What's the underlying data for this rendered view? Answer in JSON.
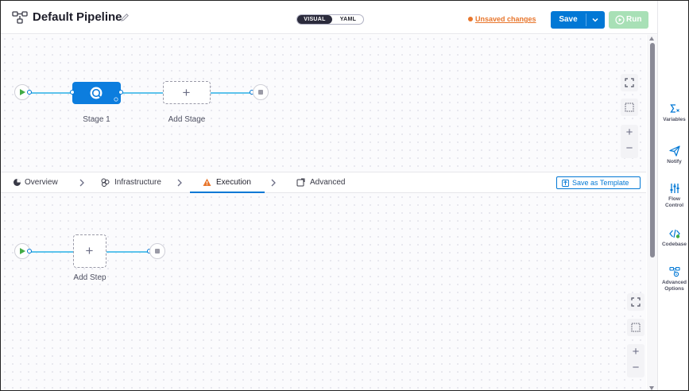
{
  "header": {
    "title": "Default Pipeline",
    "view_toggle": {
      "visual": "VISUAL",
      "yaml": "YAML",
      "selected": "VISUAL"
    },
    "unsaved": "Unsaved changes",
    "save_label": "Save",
    "run_label": "Run"
  },
  "stages": {
    "stage_label": "Stage 1",
    "add_stage_label": "Add Stage",
    "plus": "+"
  },
  "tabs": {
    "items": [
      {
        "label": "Overview"
      },
      {
        "label": "Infrastructure"
      },
      {
        "label": "Execution"
      },
      {
        "label": "Advanced"
      }
    ],
    "selected": "Execution",
    "save_as_template": "Save as Template"
  },
  "steps": {
    "add_step_label": "Add Step",
    "plus": "+"
  },
  "canvas_controls": {
    "zoom_in": "+",
    "zoom_out": "−"
  },
  "rail": {
    "items": [
      {
        "label": "Variables"
      },
      {
        "label": "Notify"
      },
      {
        "label_line1": "Flow",
        "label_line2": "Control"
      },
      {
        "label": "Codebase"
      },
      {
        "label_line1": "Advanced",
        "label_line2": "Options"
      }
    ]
  },
  "colors": {
    "brand_blue": "#0278d5",
    "unsaved_orange": "#e8762c",
    "run_disabled_green": "#a8e0b6",
    "connector": "#5dc3ec",
    "warning": "#e8762c"
  }
}
